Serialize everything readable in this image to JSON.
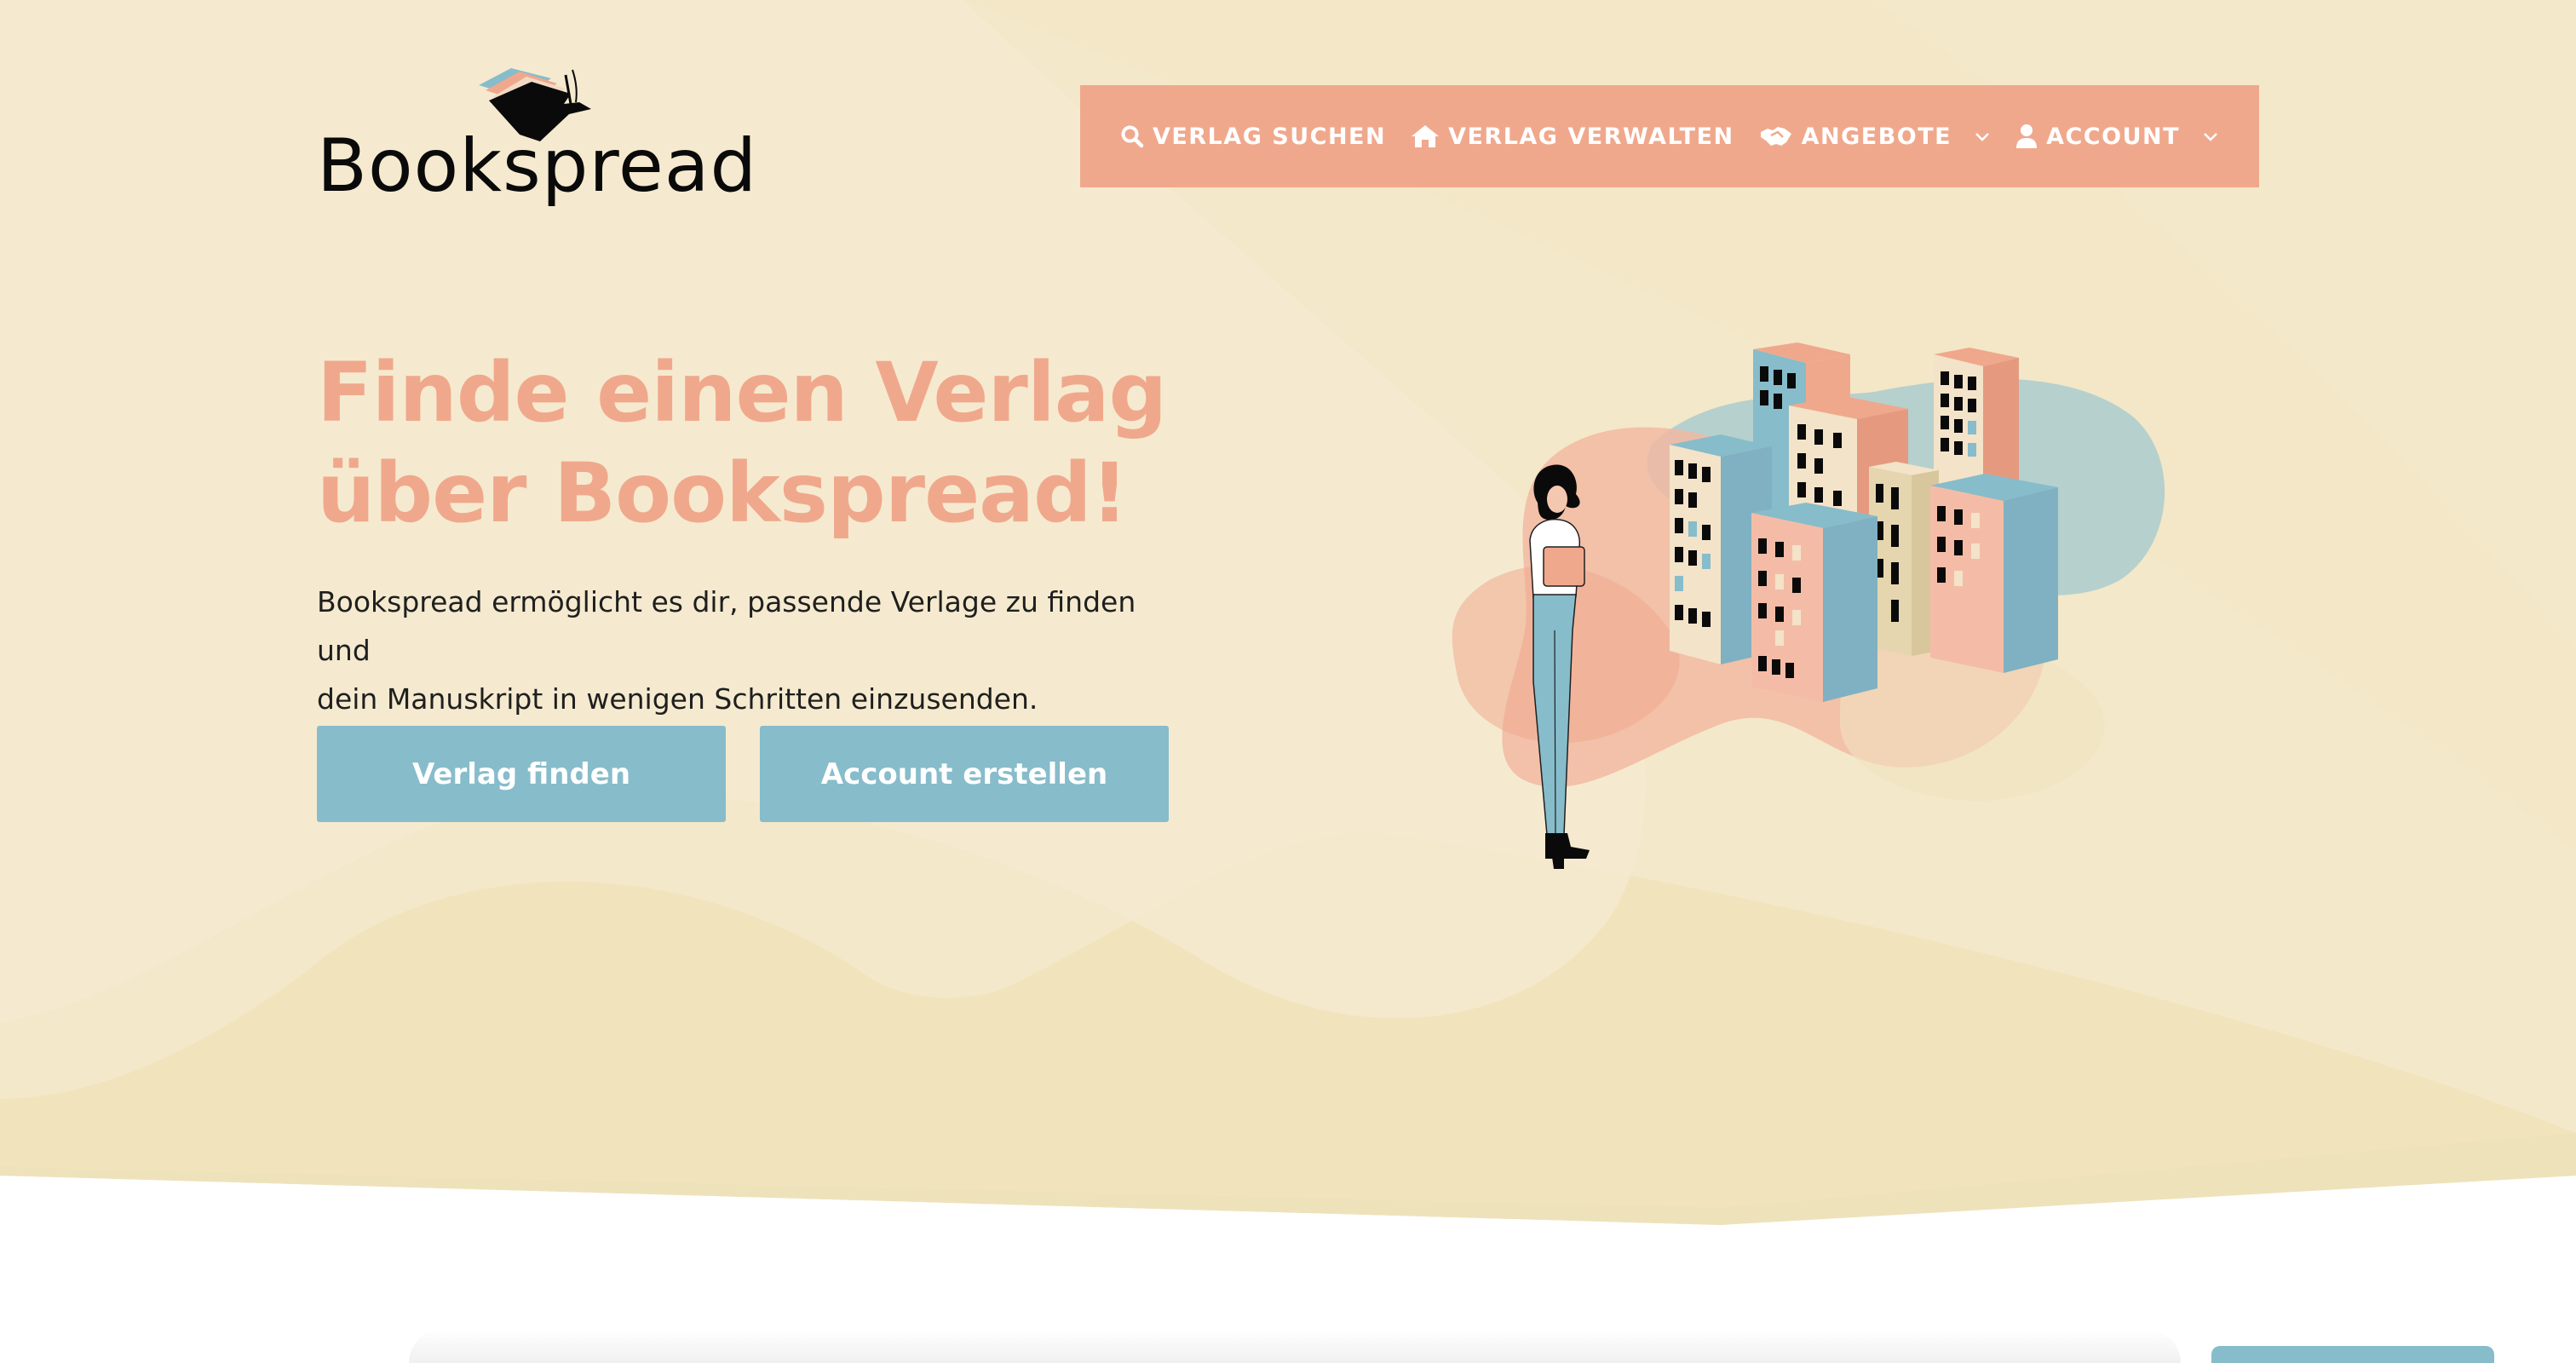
{
  "brand": {
    "name": "Bookspread",
    "colors": {
      "accent": "#f0a88c",
      "button": "#87bccb",
      "hero_background": "#f3e8c9"
    }
  },
  "nav": {
    "items": [
      {
        "label": "VERLAG SUCHEN",
        "icon": "search-icon"
      },
      {
        "label": "VERLAG VERWALTEN",
        "icon": "home-icon"
      },
      {
        "label": "ANGEBOTE",
        "icon": "handshake-icon",
        "dropdown": true
      },
      {
        "label": "ACCOUNT",
        "icon": "user-icon",
        "dropdown": true
      }
    ]
  },
  "hero": {
    "headline_line1": "Finde einen Verlag",
    "headline_line2": "über Bookspread!",
    "intro_line1": "Bookspread ermöglicht es dir, passende Verlage zu finden und",
    "intro_line2": "dein Manuskript in wenigen Schritten einzusenden.",
    "primary_button": "Verlag finden",
    "secondary_button": "Account erstellen",
    "illustration": "woman-with-book-and-city-buildings"
  }
}
